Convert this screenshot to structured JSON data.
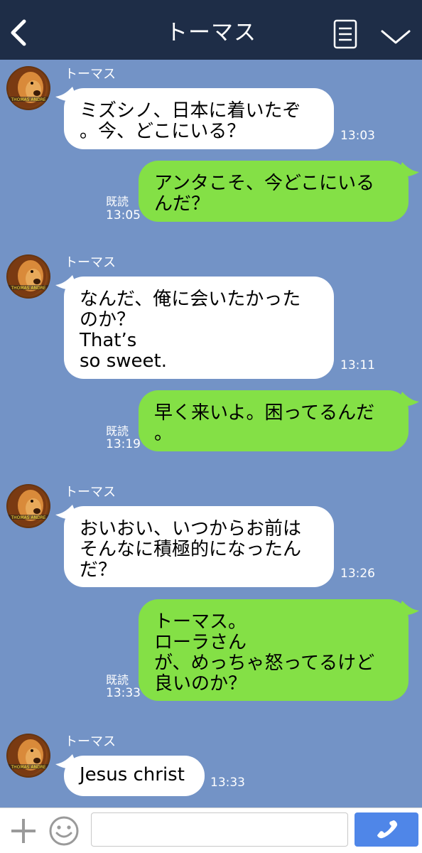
{
  "header": {
    "title": "トーマス",
    "icons": [
      "back-icon",
      "notes-icon",
      "chevron-down-icon"
    ]
  },
  "contact": {
    "name": "トーマス",
    "avatar": "lion-avatar"
  },
  "messages": [
    {
      "direction": "in",
      "sender": "トーマス",
      "text": "ミズシノ、日本に着いたぞ\n。今、どこにいる？",
      "time": "13:03"
    },
    {
      "direction": "out",
      "text": "アンタこそ、今どこにいる\nんだ？",
      "read": "既読",
      "time": "13:05"
    },
    {
      "direction": "in",
      "sender": "トーマス",
      "text": "なんだ、俺に会いたかった\nのか？\nThat’s\nso sweet.",
      "time": "13:11"
    },
    {
      "direction": "out",
      "text": "早く来いよ。困ってるんだ\n。",
      "read": "既読",
      "time": "13:19"
    },
    {
      "direction": "in",
      "sender": "トーマス",
      "text": "おいおい、いつからお前は\nそんなに積極的になったん\nだ？",
      "time": "13:26"
    },
    {
      "direction": "out",
      "text": "トーマス。\nローラさん\nが、めっちゃ怒ってるけど\n良いのか？",
      "read": "既読",
      "time": "13:33"
    },
    {
      "direction": "in",
      "sender": "トーマス",
      "text": "Jesus christ",
      "time": "13:33"
    }
  ],
  "composer": {
    "input_value": "",
    "input_placeholder": "",
    "icons": [
      "plus-icon",
      "emoji-icon",
      "phone-icon"
    ]
  },
  "colors": {
    "header_bg": "#1e2d47",
    "chat_bg": "#7393c6",
    "incoming_bubble": "#ffffff",
    "outgoing_bubble": "#84e046",
    "call_button": "#4f86e8"
  }
}
